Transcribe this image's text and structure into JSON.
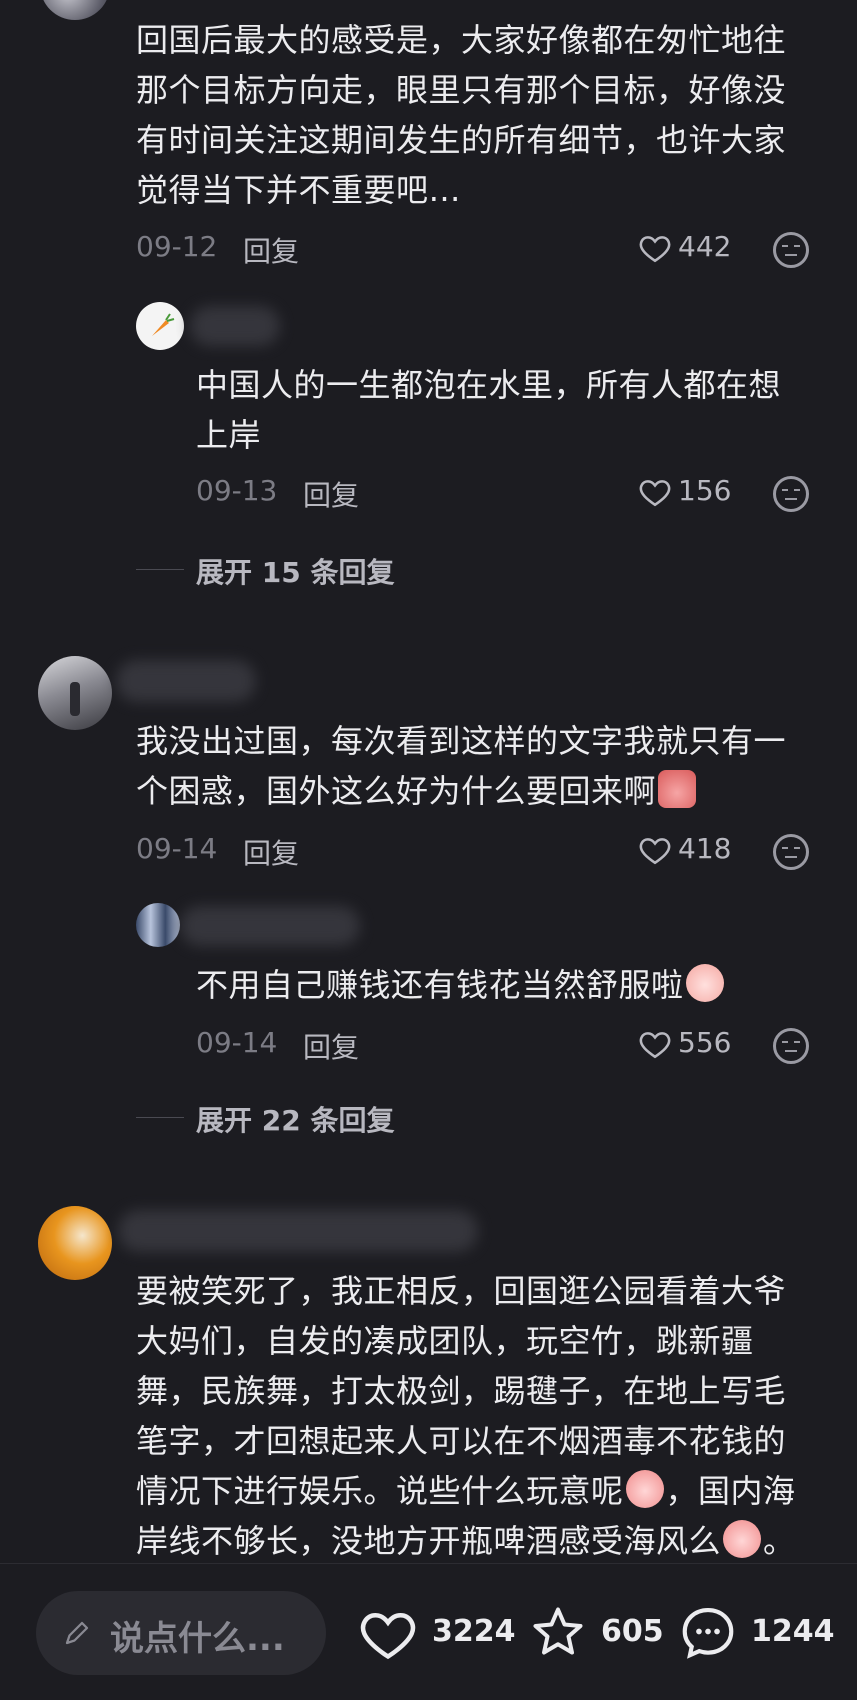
{
  "comments": [
    {
      "text": [
        "回国后最大的感受是，大家好像都在匆忙地往",
        "那个目标方向走，眼里只有那个目标，好像没",
        "有时间关注这期间发生的所有细节，也许大家",
        "觉得当下并不重要吧…"
      ],
      "date": "09-12",
      "reply": "回复",
      "likes": "442"
    },
    {
      "text": [
        "中国人的一生都泡在水里，所有人都在想",
        "上岸"
      ],
      "date": "09-13",
      "reply": "回复",
      "likes": "156"
    },
    {
      "text": [
        "我没出过国，每次看到这样的文字我就只有一",
        "个困惑，国外这么好为什么要回来啊"
      ],
      "date": "09-14",
      "reply": "回复",
      "likes": "418"
    },
    {
      "text": [
        "不用自己赚钱还有钱花当然舒服啦"
      ],
      "date": "09-14",
      "reply": "回复",
      "likes": "556"
    },
    {
      "text": [
        "要被笑死了，我正相反，回国逛公园看着大爷",
        "大妈们，自发的凑成团队，玩空竹，跳新疆",
        "舞，民族舞，打太极剑，踢毽子，在地上写毛",
        "笔字，才回想起来人可以在不烟酒毒不花钱的",
        "情况下进行娱乐。说些什么玩意呢",
        "，国内海",
        "岸线不够长，没地方开瓶啤酒感受海风么",
        "。"
      ]
    }
  ],
  "expand": [
    "展开 15 条回复",
    "展开 22 条回复"
  ],
  "bottom": {
    "placeholder": "说点什么...",
    "likes": "3224",
    "stars": "605",
    "comments": "1244"
  },
  "colors": {
    "background": "#1c1c21",
    "muted": "#7c7c85",
    "text": "#ececef"
  }
}
